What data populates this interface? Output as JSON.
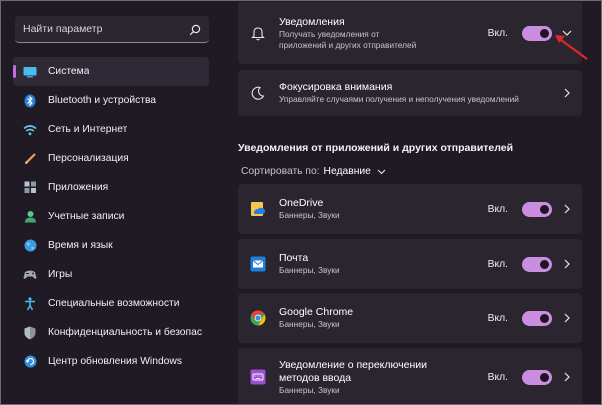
{
  "search": {
    "placeholder": "Найти параметр"
  },
  "sidebar": {
    "items": [
      {
        "label": "Система",
        "icon": "system-icon",
        "active": true
      },
      {
        "label": "Bluetooth и устройства",
        "icon": "bluetooth-icon"
      },
      {
        "label": "Сеть и Интернет",
        "icon": "wifi-icon"
      },
      {
        "label": "Персонализация",
        "icon": "brush-icon"
      },
      {
        "label": "Приложения",
        "icon": "apps-icon"
      },
      {
        "label": "Учетные записи",
        "icon": "account-icon"
      },
      {
        "label": "Время и язык",
        "icon": "globe-icon"
      },
      {
        "label": "Игры",
        "icon": "gamepad-icon"
      },
      {
        "label": "Специальные возможности",
        "icon": "accessibility-icon"
      },
      {
        "label": "Конфиденциальность и безопас",
        "icon": "shield-icon"
      },
      {
        "label": "Центр обновления Windows",
        "icon": "update-icon"
      }
    ]
  },
  "main": {
    "notifications": {
      "title": "Уведомления",
      "subtitle": "Получать уведомления от приложений и других отправителей",
      "toggle_label": "Вкл.",
      "toggle_on": true
    },
    "focus": {
      "title": "Фокусировка внимания",
      "subtitle": "Управляйте случаями получения и неполучения уведомлений"
    },
    "section_title": "Уведомления от приложений и других отправителей",
    "sort_label": "Сортировать по:",
    "sort_value": "Недавние",
    "apps": [
      {
        "name": "OneDrive",
        "sub": "Баннеры, Звуки",
        "toggle_label": "Вкл.",
        "icon": "onedrive-icon"
      },
      {
        "name": "Почта",
        "sub": "Баннеры, Звуки",
        "toggle_label": "Вкл.",
        "icon": "mail-icon"
      },
      {
        "name": "Google Chrome",
        "sub": "Баннеры, Звуки",
        "toggle_label": "Вкл.",
        "icon": "chrome-icon"
      },
      {
        "name": "Уведомление о переключении методов ввода",
        "sub": "Баннеры, Звуки",
        "toggle_label": "Вкл.",
        "icon": "keyboard-icon"
      }
    ]
  },
  "colors": {
    "accent": "#c98ee0",
    "background": "#201a25",
    "card": "#2b2530",
    "annotation_arrow": "#e0262b"
  }
}
